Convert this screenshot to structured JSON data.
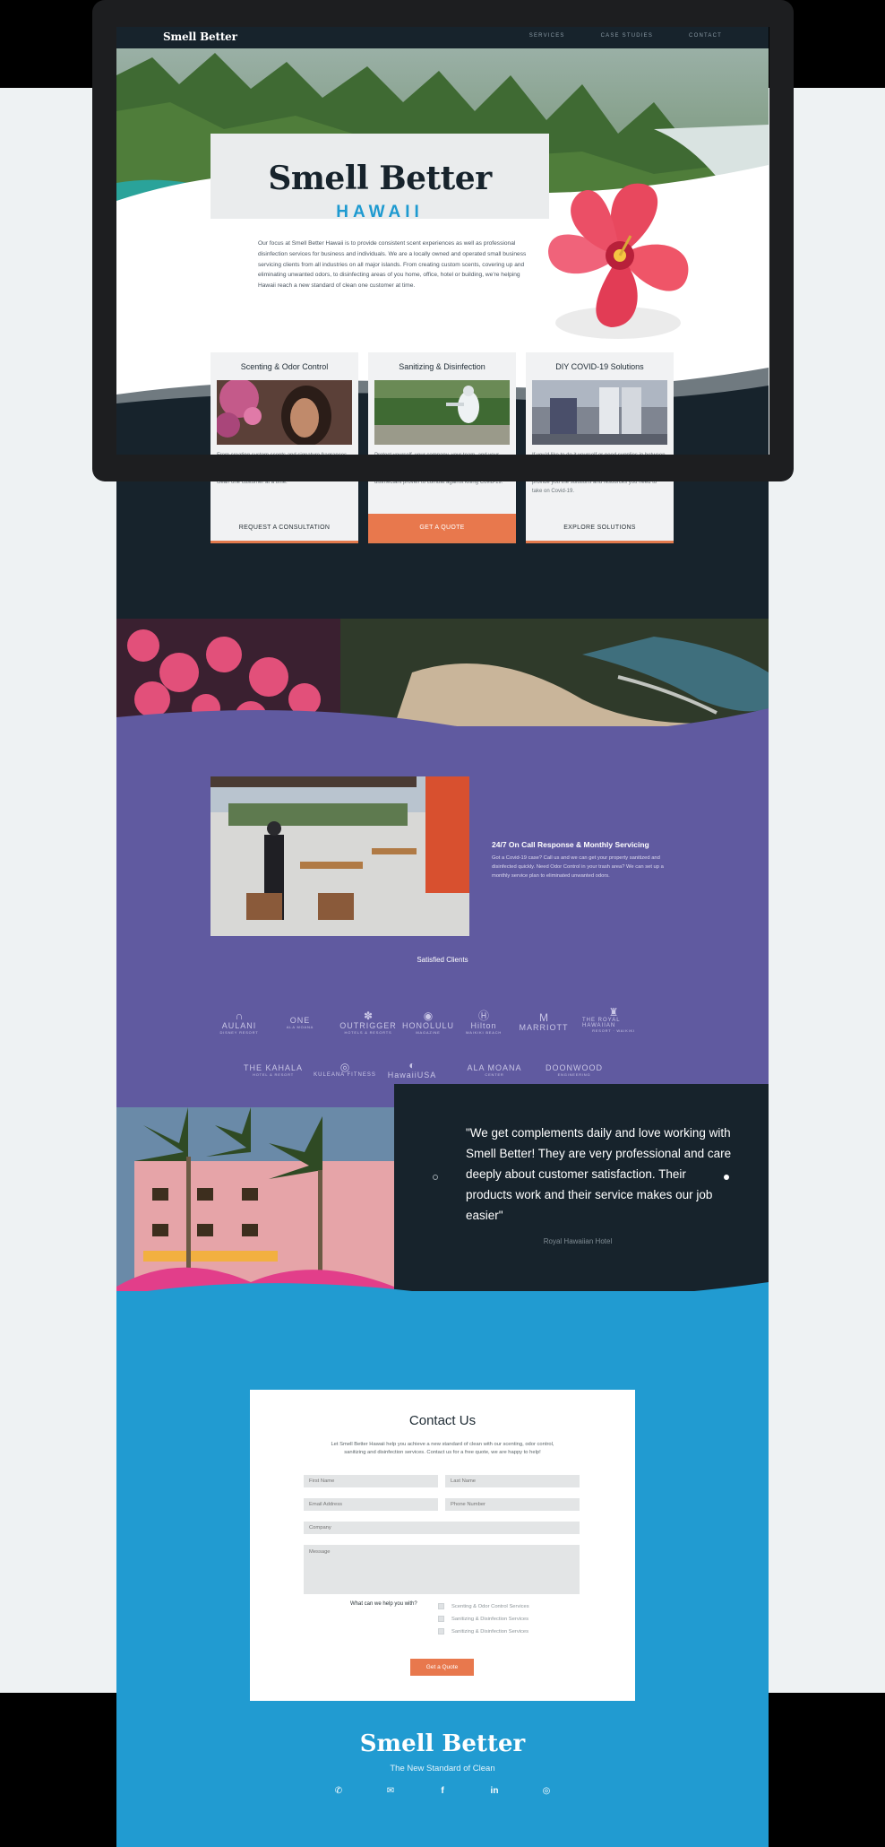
{
  "header": {
    "brand": "Smell Better",
    "nav": [
      "SERVICES",
      "CASE STUDIES",
      "CONTACT"
    ]
  },
  "hero": {
    "title": "Smell Better",
    "subtitle": "HAWAII",
    "text": "Our focus at Smell Better Hawaii is to provide consistent scent experiences as well as professional disinfection services for business and individuals. We are a locally owned and operated small business servicing clients from all industries on all major islands. From creating custom scents, covering up and eliminating unwanted odors, to disinfecting areas of you home, office, hotel or building, we're helping Hawaii reach a new standard of clean one customer at time."
  },
  "services": [
    {
      "title": "Scenting & Odor Control",
      "text": "From creating custom scents and signature fragrances for businesses to covering up and eliminating unwanted odors, we're helping Hawaii reach a new standard of clean one customer at a time.",
      "button": "REQUEST A CONSULTATION"
    },
    {
      "title": "Sanitizing & Disinfection",
      "text": "Protect yourself, your company, your team, and your guests. We follow CDC and EPA guidelines. All products are registered with the EPA including our \"N-List\" disinfectant proven to combat against killing Covid-19.",
      "button": "GET A QUOTE"
    },
    {
      "title": "DIY COVID-19 Solutions",
      "text": "If you'd like to do it yourself or need supplies in between services, we offer DIY COVID-19 solutions. Browse our selection of disinfecting and protection products. Let us provide you the solutions and resources you need to take on Covid-19.",
      "button": "EXPLORE SOLUTIONS"
    }
  ],
  "oncall": {
    "title": "24/7 On Call Response &  Monthly Servicing",
    "text": "Got a Covid-19 case? Call us and we can get your property sanitized and disinfected  quickly.  Need Odor Control in your trash area? We can set up a monthly service plan to eliminated unwanted odors."
  },
  "clients": {
    "title": "Satisfied Clients",
    "logos": [
      {
        "name": "AULANI",
        "mark": "∩",
        "sub": "DISNEY RESORT"
      },
      {
        "name": "ONE",
        "mark": "",
        "sub": "ALA MOANA"
      },
      {
        "name": "OUTRIGGER",
        "mark": "✽",
        "sub": "HOTELS & RESORTS"
      },
      {
        "name": "HONOLULU",
        "mark": "◉",
        "sub": "MAGAZINE"
      },
      {
        "name": "Hilton",
        "mark": "Ⓗ",
        "sub": "WAIKIKI BEACH"
      },
      {
        "name": "MARRIOTT",
        "mark": "M",
        "sub": ""
      },
      {
        "name": "THE ROYAL HAWAIIAN",
        "mark": "♜",
        "sub": "RESORT · WAIKIKI"
      },
      {
        "name": "THE KAHALA",
        "mark": "",
        "sub": "HOTEL & RESORT"
      },
      {
        "name": "KULEANA FITNESS",
        "mark": "◎",
        "sub": ""
      },
      {
        "name": "HawaiiUSA",
        "mark": "◐",
        "sub": ""
      },
      {
        "name": "ALA MOANA",
        "mark": "",
        "sub": "CENTER"
      },
      {
        "name": "DOONWOOD",
        "mark": "",
        "sub": "ENGINEERING"
      }
    ]
  },
  "testimonial": {
    "quote": "\"We get complements daily and love working with Smell Better! They are very professional and care deeply about customer satisfaction. Their products work and their service makes our job easier\"",
    "author": "Royal Hawaiian Hotel"
  },
  "contact": {
    "title": "Contact Us",
    "intro": "Let Smell Better Hawaii help you achieve a new standard of clean with our scenting, odor control, sanitizing and disinfection services. Contact us for a free quote, we are happy to help!",
    "placeholders": {
      "first": "First Name",
      "last": "Last Name",
      "email": "Email Address",
      "phone": "Phone Number",
      "company": "Company",
      "message": "Message"
    },
    "help_label": "What can we help you with?",
    "options": [
      "Scenting & Odor Control Services",
      "Sanitizing & Disinfection Services",
      "Sanitizing & Disinfection Services"
    ],
    "submit": "Get a Quote"
  },
  "footer": {
    "brand": "Smell Better",
    "tagline": "The New Standard of Clean",
    "icons": [
      "phone-icon",
      "email-icon",
      "facebook-icon",
      "linkedin-icon",
      "instagram-icon"
    ]
  },
  "colors": {
    "navy": "#17232c",
    "blue": "#219bd1",
    "purple": "#605aa0",
    "orange": "#e8784d"
  }
}
